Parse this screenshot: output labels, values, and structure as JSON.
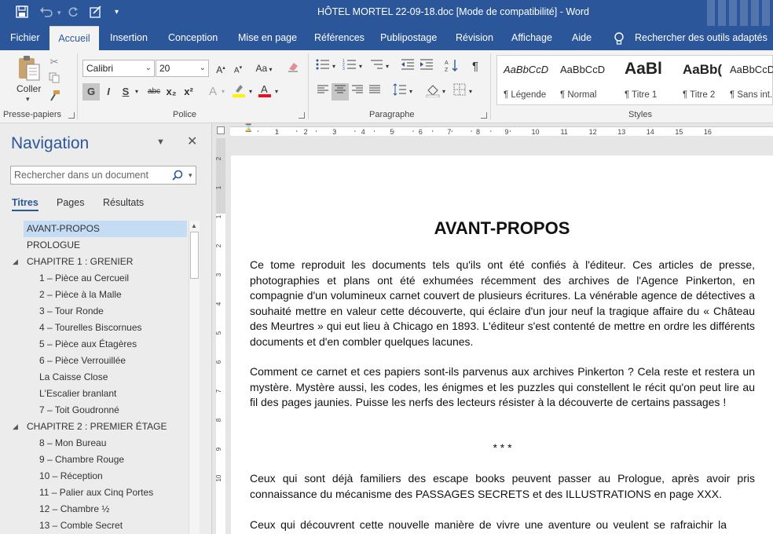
{
  "app": {
    "window_title": "HÔTEL MORTEL 22-09-18.doc [Mode de compatibilité] - Word"
  },
  "quick_access": {
    "save_icon": "save-icon",
    "undo_icon": "undo-icon",
    "redo_icon": "redo-icon",
    "touch_icon": "touch-mode-icon",
    "customize_icon": "customize-icon"
  },
  "tabs": [
    {
      "label": "Fichier"
    },
    {
      "label": "Accueil"
    },
    {
      "label": "Insertion"
    },
    {
      "label": "Conception"
    },
    {
      "label": "Mise en page"
    },
    {
      "label": "Références"
    },
    {
      "label": "Publipostage"
    },
    {
      "label": "Révision"
    },
    {
      "label": "Affichage"
    },
    {
      "label": "Aide"
    },
    {
      "label": "Rechercher des outils adaptés"
    }
  ],
  "ribbon": {
    "clipboard": {
      "paste_label": "Coller",
      "group_label": "Presse-papiers"
    },
    "font": {
      "font_name": "Calibri",
      "font_size": "20",
      "group_label": "Police",
      "bold": "G",
      "italic": "I",
      "underline": "S",
      "strike": "abc",
      "subscript": "x₂",
      "superscript": "x²",
      "case": "Aa"
    },
    "paragraph": {
      "group_label": "Paragraphe"
    },
    "styles": {
      "group_label": "Styles",
      "items": [
        {
          "preview": "AaBbCcD",
          "name": "¶ Légende"
        },
        {
          "preview": "AaBbCcD",
          "name": "¶ Normal"
        },
        {
          "preview": "AaBl",
          "name": "¶ Titre 1"
        },
        {
          "preview": "AaBb(",
          "name": "¶ Titre 2"
        },
        {
          "preview": "AaBbCcD",
          "name": "¶ Sans int..."
        }
      ]
    }
  },
  "navigation": {
    "title": "Navigation",
    "search_placeholder": "Rechercher dans un document",
    "tabs": [
      "Titres",
      "Pages",
      "Résultats"
    ],
    "headings": [
      {
        "text": "AVANT-PROPOS",
        "level": 1
      },
      {
        "text": "PROLOGUE",
        "level": 1
      },
      {
        "text": "CHAPITRE 1 : GRENIER",
        "level": 1
      },
      {
        "text": "1 – Pièce au Cercueil",
        "level": 2
      },
      {
        "text": "2 – Pièce à la Malle",
        "level": 2
      },
      {
        "text": "3 – Tour Ronde",
        "level": 2
      },
      {
        "text": "4 – Tourelles Biscornues",
        "level": 2
      },
      {
        "text": "5 – Pièce aux Étagères",
        "level": 2
      },
      {
        "text": "6 – Pièce Verrouillée",
        "level": 2
      },
      {
        "text": "La Caisse Close",
        "level": 2
      },
      {
        "text": "L'Escalier branlant",
        "level": 2
      },
      {
        "text": "7 – Toit Goudronné",
        "level": 2
      },
      {
        "text": "CHAPITRE 2 : PREMIER ÉTAGE",
        "level": 1
      },
      {
        "text": "8 – Mon Bureau",
        "level": 2
      },
      {
        "text": "9 – Chambre Rouge",
        "level": 2
      },
      {
        "text": "10 – Réception",
        "level": 2
      },
      {
        "text": "11 – Palier aux Cinq Portes",
        "level": 2
      },
      {
        "text": "12 – Chambre ½",
        "level": 2
      },
      {
        "text": "13 – Comble Secret",
        "level": 2
      }
    ]
  },
  "ruler": {
    "h_ticks": [
      "1",
      "2",
      "3",
      "4",
      "5",
      "6",
      "7",
      "8",
      "9",
      "10",
      "11",
      "12",
      "13",
      "14",
      "15",
      "16"
    ],
    "v_ticks": [
      "2",
      "1",
      "1",
      "2",
      "3",
      "4",
      "5",
      "6",
      "7",
      "8",
      "9",
      "10"
    ]
  },
  "document": {
    "title": "AVANT-PROPOS",
    "paragraphs": [
      "Ce tome reproduit les documents tels qu'ils ont été confiés à l'éditeur. Ces articles de presse, photographies et plans ont été exhumées récemment des archives de l'Agence Pinkerton, en compagnie d'un volumineux carnet couvert de plusieurs écritures. La vénérable agence de détectives a souhaité mettre en valeur cette découverte, qui éclaire d'un jour neuf la tragique affaire du « Château des Meurtres » qui eut lieu à Chicago en 1893. L'éditeur s'est contenté de mettre en ordre les différents documents et d'en combler quelques lacunes.",
      "Comment ce carnet et ces papiers sont-ils parvenus aux archives Pinkerton ? Cela reste et restera un mystère. Mystère aussi, les codes, les énigmes et les puzzles qui constellent le récit qu'on peut lire au fil des pages jaunies. Puisse les nerfs des lecteurs résister à la découverte de certains passages !",
      "* * *",
      "Ceux qui sont déjà familiers des escape books peuvent passer au Prologue, après avoir pris connaissance du mécanisme des PASSAGES SECRETS et des ILLUSTRATIONS en page XXX.",
      "Ceux qui découvrent cette nouvelle manière de vivre une aventure ou veulent se rafraichir la"
    ]
  },
  "colors": {
    "accent": "#2b579a",
    "nav_selected": "#c5dcf5"
  }
}
